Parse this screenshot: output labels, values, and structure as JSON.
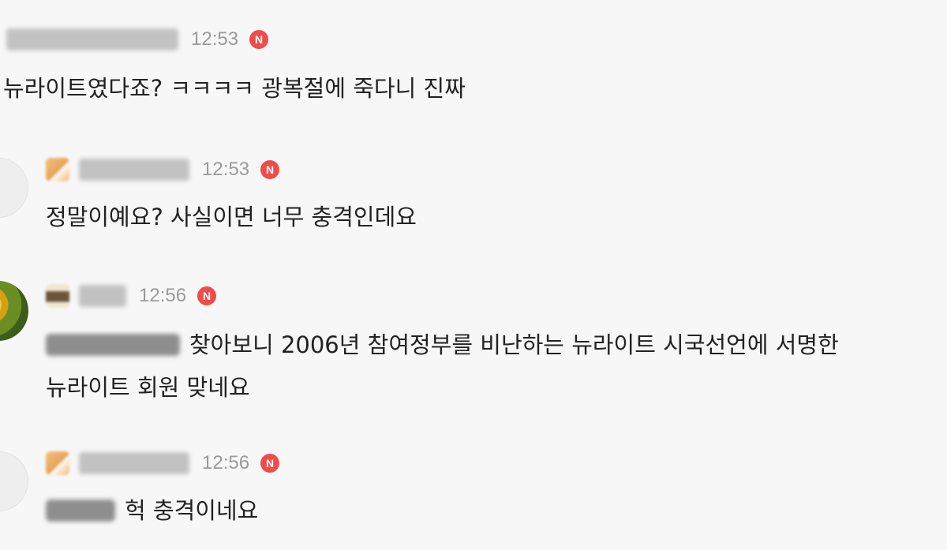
{
  "comments": [
    {
      "time": "12:53",
      "new_badge": "N",
      "text": "뉴라이트였다죠? ㅋㅋㅋㅋ 광복절에 죽다니 진짜"
    },
    {
      "time": "12:53",
      "new_badge": "N",
      "text": "정말이예요? 사실이면 너무 충격인데요"
    },
    {
      "time": "12:56",
      "new_badge": "N",
      "text_line1": "찾아보니 2006년 참여정부를 비난하는 뉴라이트 시국선언에 서명한",
      "text_line2": "뉴라이트 회원 맞네요"
    },
    {
      "time": "12:56",
      "new_badge": "N",
      "text": "헉 충격이네요"
    }
  ],
  "colors": {
    "background": "#f7f7f7",
    "new_badge": "#f04b4b",
    "timestamp": "#9a9a9a",
    "text": "#222222"
  }
}
